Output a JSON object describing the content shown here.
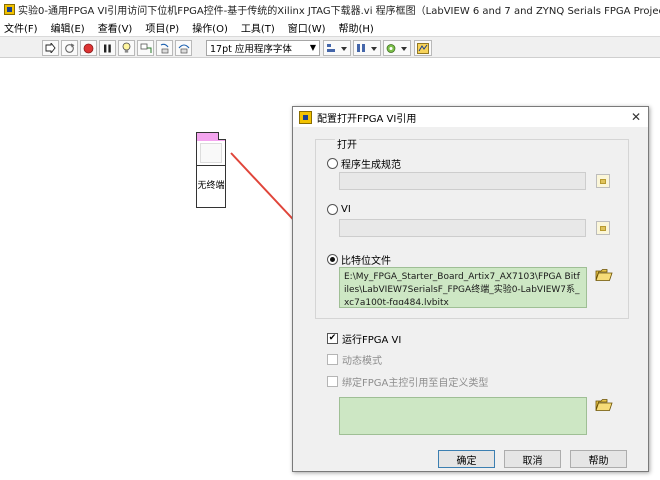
{
  "window": {
    "title": "实验0-通用FPGA VI引用访问下位机FPGA控件-基于传统的Xilinx JTAG下载器.vi 程序框图（LabVIEW 6 and 7 and ZYNQ Serials FPGA Project-SDMC FPGA"
  },
  "menu": {
    "items": [
      "文件(F)",
      "编辑(E)",
      "查看(V)",
      "项目(P)",
      "操作(O)",
      "工具(T)",
      "窗口(W)",
      "帮助(H)"
    ]
  },
  "toolbar": {
    "font_label": "17pt 应用程序字体"
  },
  "diagram": {
    "node_label": "无终端"
  },
  "dialog": {
    "title": "配置打开FPGA VI引用",
    "group_label": "打开",
    "options": [
      {
        "label": "程序生成规范",
        "selected": false
      },
      {
        "label": "VI",
        "selected": false
      },
      {
        "label": "比特位文件",
        "selected": true
      }
    ],
    "bitfile_path": "E:\\My_FPGA_Starter_Board_Artix7_AX7103\\FPGA Bitfiles\\LabVIEW7SerialsF_FPGA终端_实验0-LabVIEW7系_xc7a100t-fgg484.lvbitx",
    "run_fpga_vi": {
      "label": "运行FPGA VI",
      "checked": true
    },
    "dynamic_mode": {
      "label": "动态模式",
      "checked": false
    },
    "bind_fpga": {
      "label": "绑定FPGA主控引用至自定义类型",
      "checked": false
    },
    "buttons": {
      "ok": "确定",
      "cancel": "取消",
      "help": "帮助"
    }
  },
  "colors": {
    "path_green": "#cde7c4",
    "arrow_red": "#e0453a",
    "node_pink": "#f4a5ef"
  }
}
